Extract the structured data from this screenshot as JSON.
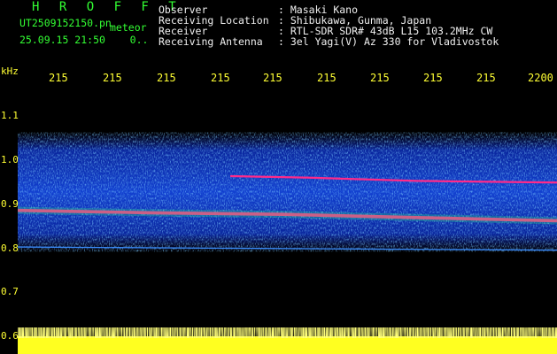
{
  "brand": "H R O F F T",
  "file_name": "UT2509152150.pn",
  "file_tag": "meteor",
  "datetime": "25.09.15 21:50",
  "datetime_suffix": "0..",
  "header": {
    "rows": [
      {
        "key": "Observer",
        "sep": ":",
        "value": "Masaki Kano"
      },
      {
        "key": "Receiving Location",
        "sep": ":",
        "value": "Shibukawa, Gunma, Japan"
      },
      {
        "key": "Receiver",
        "sep": ":",
        "value": "RTL-SDR SDR# 43dB L15 103.2MHz CW"
      },
      {
        "key": "Receiving Antenna",
        "sep": ":",
        "value": "3el Yagi(V) Az 330 for Vladivostok"
      }
    ]
  },
  "x_axis": {
    "ticks": [
      "215",
      "215",
      "215",
      "215",
      "215",
      "215",
      "215",
      "215",
      "215",
      "2200"
    ]
  },
  "y_axis": {
    "unit": "kHz",
    "ticks": [
      "1.1",
      "1.0",
      "0.9",
      "0.8",
      "0.7",
      "0.6"
    ]
  },
  "colors": {
    "text_green": "#33ff33",
    "text_white": "#f0f0f0",
    "text_yellow": "#ffff33",
    "background": "#000000"
  }
}
